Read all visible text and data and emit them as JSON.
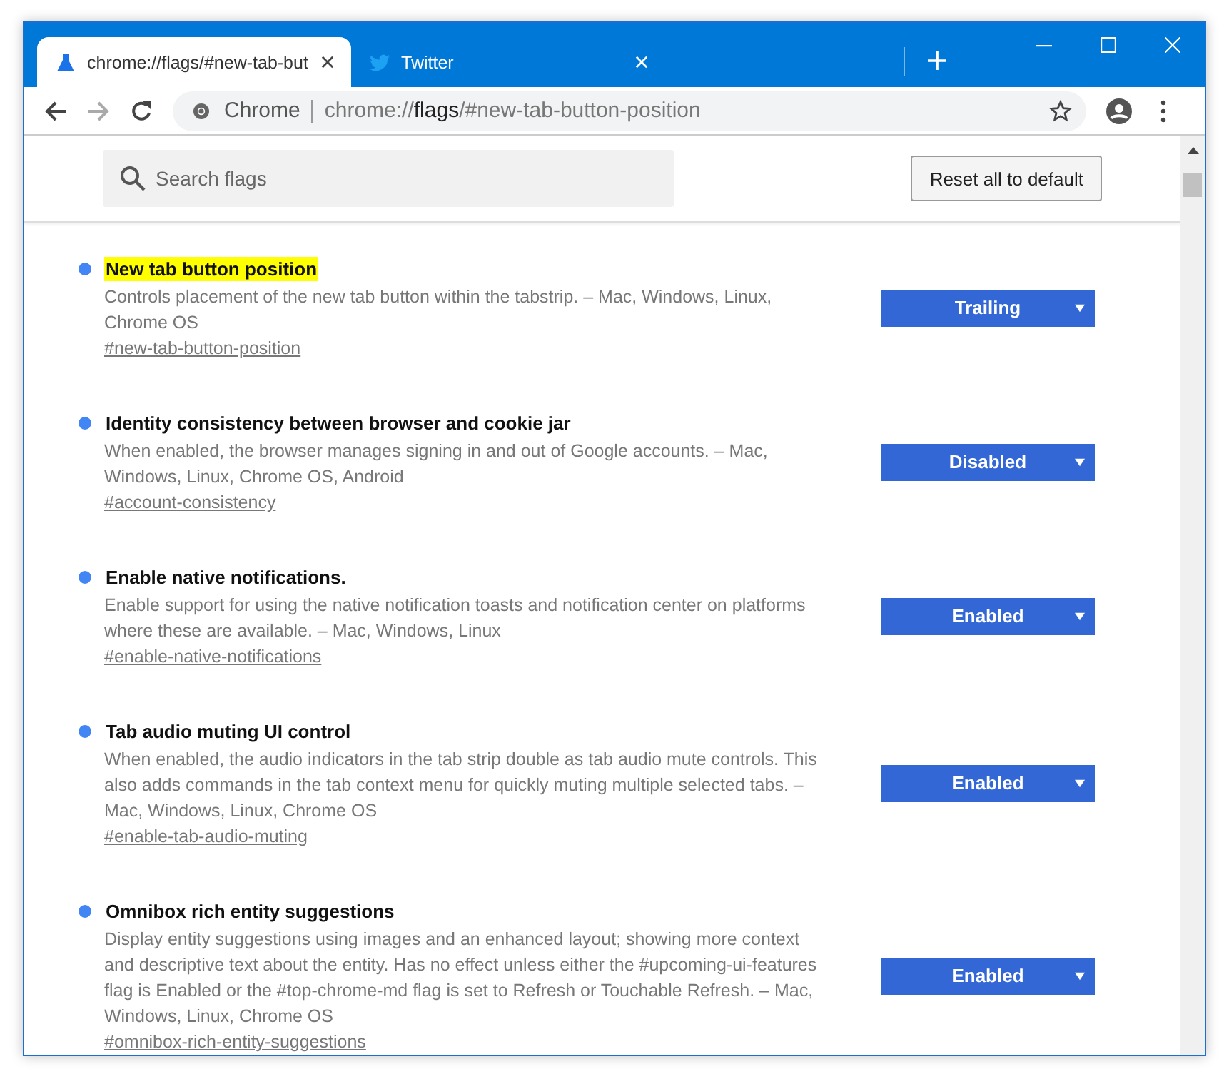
{
  "tabs": [
    {
      "title": "chrome://flags/#new-tab-but",
      "selected": true
    },
    {
      "title": "Twitter",
      "selected": false
    }
  ],
  "omnibox": {
    "site": "Chrome",
    "url_scheme": "chrome://",
    "url_host": "flags",
    "url_path": "/#new-tab-button-position"
  },
  "search": {
    "placeholder": "Search flags"
  },
  "reset_button": "Reset all to default",
  "flags": [
    {
      "title": "New tab button position",
      "highlighted": true,
      "description": "Controls placement of the new tab button within the tabstrip. – Mac, Windows, Linux, Chrome OS",
      "link": "#new-tab-button-position",
      "value": "Trailing"
    },
    {
      "title": "Identity consistency between browser and cookie jar",
      "highlighted": false,
      "description": "When enabled, the browser manages signing in and out of Google accounts. – Mac, Windows, Linux, Chrome OS, Android",
      "link": "#account-consistency",
      "value": "Disabled"
    },
    {
      "title": "Enable native notifications.",
      "highlighted": false,
      "description": "Enable support for using the native notification toasts and notification center on platforms where these are available. – Mac, Windows, Linux",
      "link": "#enable-native-notifications",
      "value": "Enabled"
    },
    {
      "title": "Tab audio muting UI control",
      "highlighted": false,
      "description": "When enabled, the audio indicators in the tab strip double as tab audio mute controls. This also adds commands in the tab context menu for quickly muting multiple selected tabs. – Mac, Windows, Linux, Chrome OS",
      "link": "#enable-tab-audio-muting",
      "value": "Enabled"
    },
    {
      "title": "Omnibox rich entity suggestions",
      "highlighted": false,
      "description": "Display entity suggestions using images and an enhanced layout; showing more context and descriptive text about the entity. Has no effect unless either the #upcoming-ui-features flag is Enabled or the #top-chrome-md flag is set to Refresh or Touchable Refresh. – Mac, Windows, Linux, Chrome OS",
      "link": "#omnibox-rich-entity-suggestions",
      "value": "Enabled"
    }
  ]
}
